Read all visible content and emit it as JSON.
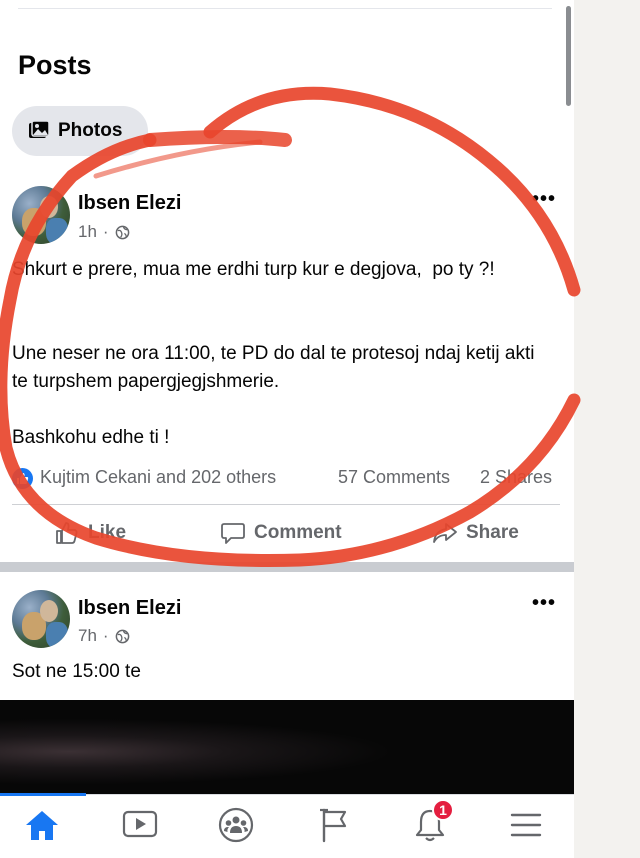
{
  "section": {
    "heading": "Posts",
    "photos_chip": "Photos"
  },
  "post1": {
    "author": "Ibsen Elezi",
    "time": "1h",
    "dot": "·",
    "text_p1": "Shkurt e prere, mua me erdhi turp kur e degjova,  po ty ?!",
    "text_p2": "Une neser ne ora 11:00, te PD do dal te protesoj ndaj ketij akti te turpshem papergjegjshmerie.",
    "text_p3": "Bashkohu edhe ti !",
    "reactors": "Kujtim Cekani and 202 others",
    "comments": "57 Comments",
    "shares": "2 Shares",
    "more": "•••",
    "actions": {
      "like": "Like",
      "comment": "Comment",
      "share": "Share"
    }
  },
  "post2": {
    "author": "Ibsen Elezi",
    "time": "7h",
    "dot": "·",
    "text": "Sot ne 15:00 te",
    "more": "•••"
  },
  "bottom_nav": {
    "items": [
      "home-icon",
      "video-icon",
      "groups-icon",
      "pages-flag-icon",
      "notifications-bell-icon",
      "menu-icon"
    ],
    "notification_count": "1",
    "active_color": "#1877f2"
  },
  "annotation": {
    "color": "#e8452c"
  }
}
